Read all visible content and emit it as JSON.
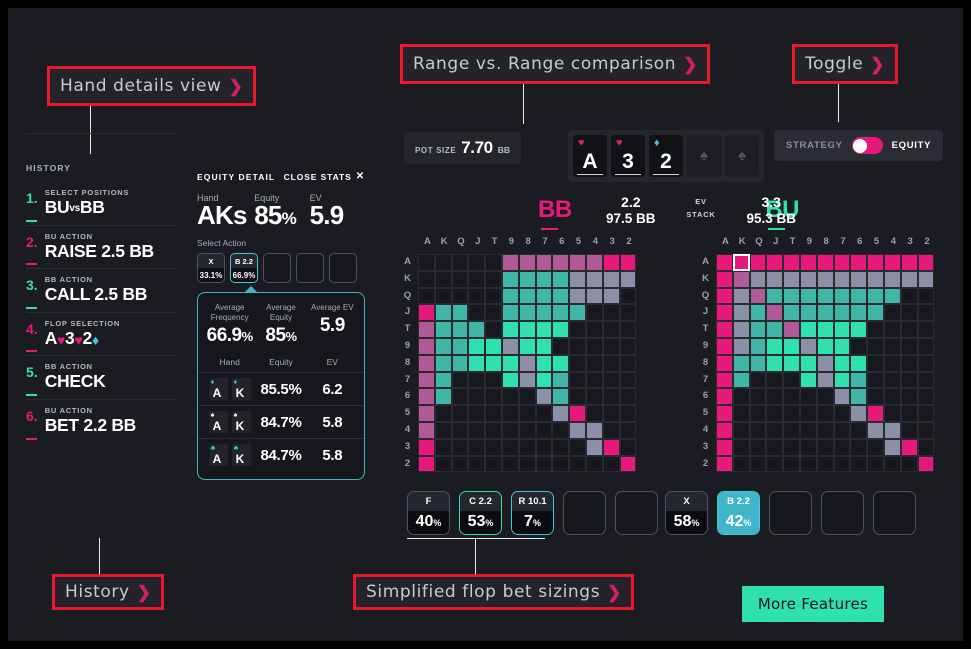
{
  "annotations": [
    {
      "id": "hand-details-view",
      "label": "Hand details view",
      "chev": "❯"
    },
    {
      "id": "range-vs-range",
      "label": "Range vs. Range comparison",
      "chev": "❯"
    },
    {
      "id": "toggle",
      "label": "Toggle",
      "chev": "❯"
    },
    {
      "id": "history",
      "label": "History",
      "chev": "❯"
    },
    {
      "id": "simplified-flop-bet-sizings",
      "label": "Simplified flop bet sizings",
      "chev": "❯"
    }
  ],
  "history": {
    "title": "HISTORY",
    "items": [
      {
        "num": "1.",
        "label": "SELECT POSITIONS",
        "value": "BU",
        "vs": "vs",
        "value2": "BB",
        "color": "#2fe0b0"
      },
      {
        "num": "2.",
        "label": "BU ACTION",
        "value": "RAISE 2.5 BB",
        "color": "#e8197c"
      },
      {
        "num": "3.",
        "label": "BB ACTION",
        "value": "CALL 2.5 BB",
        "color": "#2fe0b0"
      },
      {
        "num": "4.",
        "label": "FLOP SELECTION",
        "value": "A",
        "suits": [
          {
            "g": "♥",
            "c": "#e8197c"
          },
          {
            "r": "3"
          },
          {
            "g": "♥",
            "c": "#e8197c"
          },
          {
            "r": "2"
          },
          {
            "g": "♦",
            "c": "#3ec6e0"
          }
        ],
        "color": "#e8197c"
      },
      {
        "num": "5.",
        "label": "BB ACTION",
        "value": "CHECK",
        "color": "#2fe0b0"
      },
      {
        "num": "6.",
        "label": "BU ACTION",
        "value": "BET 2.2 BB",
        "color": "#e8197c"
      }
    ]
  },
  "equity_detail": {
    "title": "EQUITY DETAIL",
    "close_label": "CLOSE STATS",
    "close_icon": "✕",
    "fields": [
      {
        "key": "Hand",
        "value": "AKs"
      },
      {
        "key": "Equity",
        "value": "85",
        "unit": "%"
      },
      {
        "key": "EV",
        "value": "5.9",
        "unit": ""
      }
    ],
    "select_action_label": "Select Action",
    "actions": [
      {
        "top": "X",
        "bottom": "33.1%",
        "active": false
      },
      {
        "top": "B 2.2",
        "bottom": "66.9%",
        "active": true
      },
      {
        "top": "",
        "bottom": "",
        "active": false,
        "blank": true
      },
      {
        "top": "",
        "bottom": "",
        "active": false,
        "blank": true
      },
      {
        "top": "",
        "bottom": "",
        "active": false,
        "blank": true
      }
    ],
    "averages": [
      {
        "k1": "Average",
        "k2": "Frequency",
        "v": "66.9",
        "u": "%"
      },
      {
        "k1": "Average",
        "k2": "Equity",
        "v": "85",
        "u": "%"
      },
      {
        "k1": "",
        "k2": "Average EV",
        "v": "5.9",
        "u": ""
      }
    ],
    "table_headers": [
      "Hand",
      "Equity",
      "EV"
    ],
    "table_rows": [
      {
        "cards": [
          {
            "r": "A",
            "s": "♦",
            "c": "#3ec6e0"
          },
          {
            "r": "K",
            "s": "♦",
            "c": "#3ec6e0"
          }
        ],
        "equity": "85.5%",
        "ev": "6.2"
      },
      {
        "cards": [
          {
            "r": "A",
            "s": "♠",
            "c": "#ffffff"
          },
          {
            "r": "K",
            "s": "♠",
            "c": "#ffffff"
          }
        ],
        "equity": "84.7%",
        "ev": "5.8"
      },
      {
        "cards": [
          {
            "r": "A",
            "s": "♣",
            "c": "#2fe0b0"
          },
          {
            "r": "K",
            "s": "♣",
            "c": "#2fe0b0"
          }
        ],
        "equity": "84.7%",
        "ev": "5.8"
      }
    ]
  },
  "pot": {
    "label": "POT SIZE",
    "value": "7.70",
    "unit": "BB"
  },
  "board": {
    "cards": [
      {
        "rank": "A",
        "suit": "♥",
        "color": "#e8197c",
        "empty": false
      },
      {
        "rank": "3",
        "suit": "♥",
        "color": "#e8197c",
        "empty": false
      },
      {
        "rank": "2",
        "suit": "♦",
        "color": "#3ec6e0",
        "empty": false
      },
      {
        "rank": "",
        "suit": "♠",
        "color": "#50545f",
        "empty": true
      },
      {
        "rank": "",
        "suit": "♠",
        "color": "#50545f",
        "empty": true
      }
    ]
  },
  "players": {
    "left": {
      "name": "BB",
      "color": "#e8197c",
      "ev": "2.2",
      "stack": "97.5 BB"
    },
    "right": {
      "name": "BU",
      "color": "#2fe0b0",
      "ev": "3.3",
      "stack": "95.3 BB"
    },
    "ev_label": "EV",
    "stack_label": "STACK"
  },
  "toggle": {
    "left_label": "STRATEGY",
    "right_label": "EQUITY",
    "track_color": "#e8197c",
    "knob_color": "#ffffff"
  },
  "more_features": {
    "label": "More Features",
    "color": "#2fe0b0"
  },
  "matrix": {
    "ranks": [
      "A",
      "K",
      "Q",
      "J",
      "T",
      "9",
      "8",
      "7",
      "6",
      "5",
      "4",
      "3",
      "2"
    ],
    "palette": {
      "empty": "#18191e",
      "pink": "#e8197c",
      "mauve": "#b05a9a",
      "teal": "#3fb6a8",
      "green": "#2fe0b0",
      "slate": "#8b8fa8"
    }
  },
  "chart_data": {
    "type": "heatmap",
    "title": "Range vs Range comparison",
    "xlabel": "",
    "ylabel": "",
    "categories": [
      "A",
      "K",
      "Q",
      "J",
      "T",
      "9",
      "8",
      "7",
      "6",
      "5",
      "4",
      "3",
      "2"
    ],
    "legend": [
      "empty",
      "pink",
      "mauve",
      "teal",
      "green",
      "slate"
    ],
    "series": [
      {
        "name": "BB range",
        "selected": null,
        "values": [
          [
            "empty",
            "empty",
            "empty",
            "empty",
            "empty",
            "mauve",
            "mauve",
            "mauve",
            "mauve",
            "mauve",
            "mauve",
            "pink",
            "pink"
          ],
          [
            "empty",
            "empty",
            "empty",
            "empty",
            "empty",
            "teal",
            "teal",
            "teal",
            "teal",
            "slate",
            "slate",
            "slate",
            "slate"
          ],
          [
            "empty",
            "empty",
            "empty",
            "empty",
            "empty",
            "teal",
            "teal",
            "teal",
            "teal",
            "slate",
            "slate",
            "slate",
            "empty"
          ],
          [
            "pink",
            "teal",
            "teal",
            "empty",
            "empty",
            "teal",
            "teal",
            "teal",
            "teal",
            "teal",
            "empty",
            "empty",
            "empty"
          ],
          [
            "mauve",
            "teal",
            "teal",
            "teal",
            "empty",
            "green",
            "green",
            "green",
            "green",
            "empty",
            "empty",
            "empty",
            "empty"
          ],
          [
            "mauve",
            "teal",
            "teal",
            "green",
            "green",
            "slate",
            "green",
            "green",
            "empty",
            "empty",
            "empty",
            "empty",
            "empty"
          ],
          [
            "mauve",
            "teal",
            "teal",
            "green",
            "green",
            "green",
            "slate",
            "green",
            "green",
            "empty",
            "empty",
            "empty",
            "empty"
          ],
          [
            "mauve",
            "teal",
            "empty",
            "empty",
            "empty",
            "green",
            "slate",
            "green",
            "teal",
            "empty",
            "empty",
            "empty",
            "empty"
          ],
          [
            "mauve",
            "teal",
            "empty",
            "empty",
            "empty",
            "empty",
            "empty",
            "slate",
            "teal",
            "empty",
            "empty",
            "empty",
            "empty"
          ],
          [
            "mauve",
            "empty",
            "empty",
            "empty",
            "empty",
            "empty",
            "empty",
            "empty",
            "slate",
            "pink",
            "empty",
            "empty",
            "empty"
          ],
          [
            "mauve",
            "empty",
            "empty",
            "empty",
            "empty",
            "empty",
            "empty",
            "empty",
            "empty",
            "slate",
            "slate",
            "empty",
            "empty"
          ],
          [
            "pink",
            "empty",
            "empty",
            "empty",
            "empty",
            "empty",
            "empty",
            "empty",
            "empty",
            "empty",
            "slate",
            "pink",
            "empty"
          ],
          [
            "pink",
            "empty",
            "empty",
            "empty",
            "empty",
            "empty",
            "empty",
            "empty",
            "empty",
            "empty",
            "empty",
            "empty",
            "pink"
          ]
        ]
      },
      {
        "name": "BU range",
        "selected": [
          0,
          1
        ],
        "values": [
          [
            "pink",
            "pink",
            "pink",
            "pink",
            "pink",
            "pink",
            "pink",
            "pink",
            "pink",
            "pink",
            "pink",
            "pink",
            "pink"
          ],
          [
            "pink",
            "mauve",
            "slate",
            "slate",
            "slate",
            "slate",
            "slate",
            "slate",
            "slate",
            "slate",
            "slate",
            "slate",
            "slate"
          ],
          [
            "pink",
            "slate",
            "mauve",
            "teal",
            "teal",
            "teal",
            "teal",
            "teal",
            "teal",
            "teal",
            "teal",
            "empty",
            "empty"
          ],
          [
            "pink",
            "slate",
            "teal",
            "mauve",
            "teal",
            "teal",
            "teal",
            "teal",
            "teal",
            "teal",
            "empty",
            "empty",
            "empty"
          ],
          [
            "pink",
            "slate",
            "teal",
            "teal",
            "mauve",
            "green",
            "green",
            "green",
            "green",
            "empty",
            "empty",
            "empty",
            "empty"
          ],
          [
            "pink",
            "slate",
            "teal",
            "green",
            "green",
            "slate",
            "green",
            "green",
            "empty",
            "empty",
            "empty",
            "empty",
            "empty"
          ],
          [
            "pink",
            "teal",
            "teal",
            "green",
            "green",
            "green",
            "slate",
            "green",
            "green",
            "empty",
            "empty",
            "empty",
            "empty"
          ],
          [
            "pink",
            "teal",
            "empty",
            "empty",
            "empty",
            "green",
            "slate",
            "green",
            "teal",
            "empty",
            "empty",
            "empty",
            "empty"
          ],
          [
            "pink",
            "empty",
            "empty",
            "empty",
            "empty",
            "empty",
            "empty",
            "slate",
            "teal",
            "empty",
            "empty",
            "empty",
            "empty"
          ],
          [
            "pink",
            "empty",
            "empty",
            "empty",
            "empty",
            "empty",
            "empty",
            "empty",
            "slate",
            "pink",
            "empty",
            "empty",
            "empty"
          ],
          [
            "pink",
            "empty",
            "empty",
            "empty",
            "empty",
            "empty",
            "empty",
            "empty",
            "empty",
            "slate",
            "slate",
            "empty",
            "empty"
          ],
          [
            "pink",
            "empty",
            "empty",
            "empty",
            "empty",
            "empty",
            "empty",
            "empty",
            "empty",
            "empty",
            "slate",
            "pink",
            "empty"
          ],
          [
            "pink",
            "empty",
            "empty",
            "empty",
            "empty",
            "empty",
            "empty",
            "empty",
            "empty",
            "empty",
            "empty",
            "empty",
            "pink"
          ]
        ]
      }
    ]
  },
  "strategy_left": [
    {
      "top": "F",
      "bottom": "40",
      "unit": "%",
      "state": "plain"
    },
    {
      "top": "C 2.2",
      "bottom": "53",
      "unit": "%",
      "state": "on-t"
    },
    {
      "top": "R 10.1",
      "bottom": "7",
      "unit": "%",
      "state": "on-c"
    },
    {
      "top": "",
      "bottom": "",
      "unit": "",
      "state": "blank"
    },
    {
      "top": "",
      "bottom": "",
      "unit": "",
      "state": "blank"
    }
  ],
  "strategy_right": [
    {
      "top": "X",
      "bottom": "58",
      "unit": "%",
      "state": "plain"
    },
    {
      "top": "B 2.2",
      "bottom": "42",
      "unit": "%",
      "state": "fill"
    },
    {
      "top": "",
      "bottom": "",
      "unit": "",
      "state": "blank"
    },
    {
      "top": "",
      "bottom": "",
      "unit": "",
      "state": "blank"
    },
    {
      "top": "",
      "bottom": "",
      "unit": "",
      "state": "blank"
    }
  ]
}
